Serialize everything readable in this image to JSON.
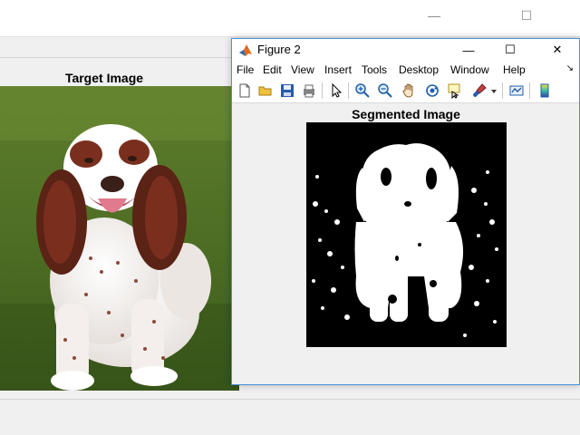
{
  "background_window": {
    "controls": [
      "—",
      "☐",
      "✕"
    ],
    "target_title": "Target Image"
  },
  "figure2": {
    "title": "Figure 2",
    "controls": [
      "—",
      "☐",
      "✕"
    ],
    "menu": [
      "File",
      "Edit",
      "View",
      "Insert",
      "Tools",
      "Desktop",
      "Window",
      "Help"
    ],
    "menu_arrow": "↘",
    "toolbar_icons": [
      "new-figure-icon",
      "open-folder-icon",
      "save-icon",
      "print-icon",
      "select-pointer-icon",
      "zoom-in-icon",
      "zoom-out-icon",
      "pan-hand-icon",
      "rotate-3d-icon",
      "data-cursor-icon",
      "brush-icon",
      "dropdown-arrow-icon",
      "link-plot-icon",
      "colorbar-icon"
    ],
    "seg_title": "Segmented Image"
  },
  "colors": {
    "accent": "#4a90d9",
    "window_bg": "#f0f0f0",
    "titlebar_bg": "#ffffff"
  }
}
